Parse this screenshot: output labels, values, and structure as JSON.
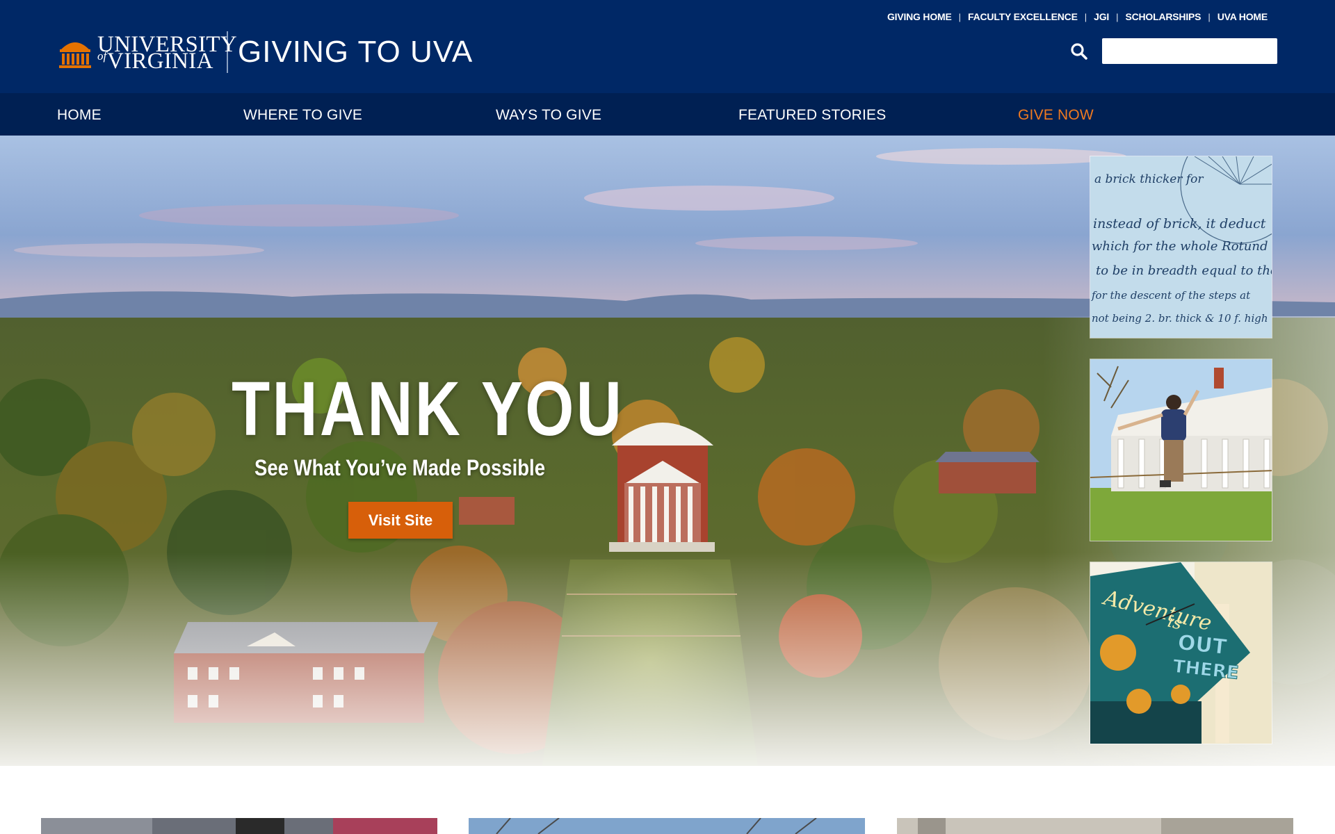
{
  "utility_nav": [
    {
      "label": "GIVING HOME"
    },
    {
      "label": "FACULTY EXCELLENCE"
    },
    {
      "label": "JGI"
    },
    {
      "label": "SCHOLARSHIPS"
    },
    {
      "label": "UVA HOME"
    }
  ],
  "utility_separator": "|",
  "logo": {
    "line1": "UNIVERSITY",
    "of": "of",
    "line2": "VIRGINIA",
    "site_title": "GIVING TO UVA",
    "icon": "rotunda-icon"
  },
  "search": {
    "icon": "search-icon",
    "placeholder": "",
    "value": ""
  },
  "main_nav": [
    {
      "label": "HOME"
    },
    {
      "label": "WHERE TO GIVE"
    },
    {
      "label": "WAYS TO GIVE"
    },
    {
      "label": "FEATURED STORIES"
    },
    {
      "label": "GIVE NOW"
    }
  ],
  "hero": {
    "title": "THANK YOU",
    "subtitle": "See What You’ve Made Possible",
    "button_label": "Visit Site"
  },
  "thumbnails": [
    {
      "name": "manuscript-thumbnail",
      "handwriting": [
        "a brick thicker for",
        "instead of brick, it deduct",
        "which for the whole Rotund",
        "to be in breadth equal to the",
        "for the descent of the steps at",
        "not being 2. br. thick & 10 f. high"
      ]
    },
    {
      "name": "slackline-thumbnail"
    },
    {
      "name": "graduation-cap-thumbnail",
      "cap_text": [
        "Adventure",
        "is",
        "OUT",
        "THERE"
      ]
    }
  ],
  "colors": {
    "header_bg": "#002866",
    "nav_bg": "#002053",
    "accent_orange": "#f07a20",
    "button_orange": "#d75f0a"
  }
}
